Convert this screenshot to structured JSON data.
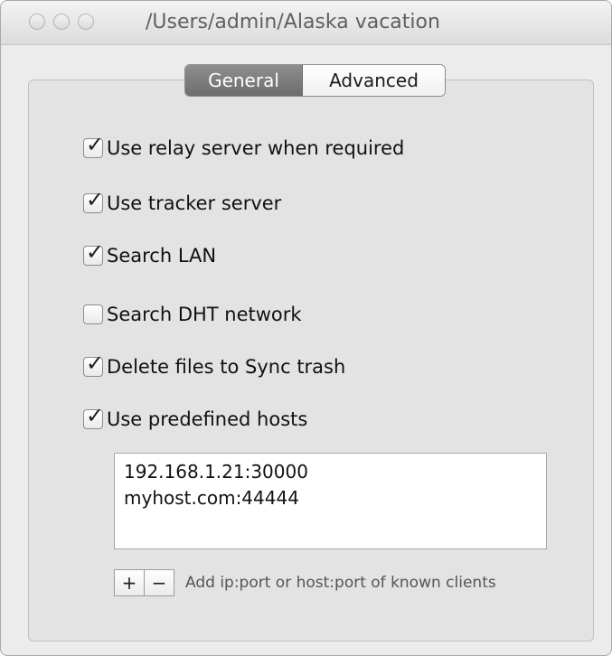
{
  "window": {
    "title": "/Users/admin/Alaska vacation"
  },
  "tabs": [
    {
      "label": "General",
      "selected": true
    },
    {
      "label": "Advanced",
      "selected": false
    }
  ],
  "options": [
    {
      "label": "Use relay server when required",
      "checked": true
    },
    {
      "label": "Use tracker server",
      "checked": true
    },
    {
      "label": "Search LAN",
      "checked": true
    },
    {
      "label": "Search DHT network",
      "checked": false
    },
    {
      "label": "Delete files to Sync trash",
      "checked": true
    },
    {
      "label": "Use predefined hosts",
      "checked": true
    }
  ],
  "hosts": [
    "192.168.1.21:30000",
    "myhost.com:44444"
  ],
  "host_controls": {
    "add_label": "+",
    "remove_label": "−",
    "hint": "Add ip:port or host:port of known clients"
  }
}
